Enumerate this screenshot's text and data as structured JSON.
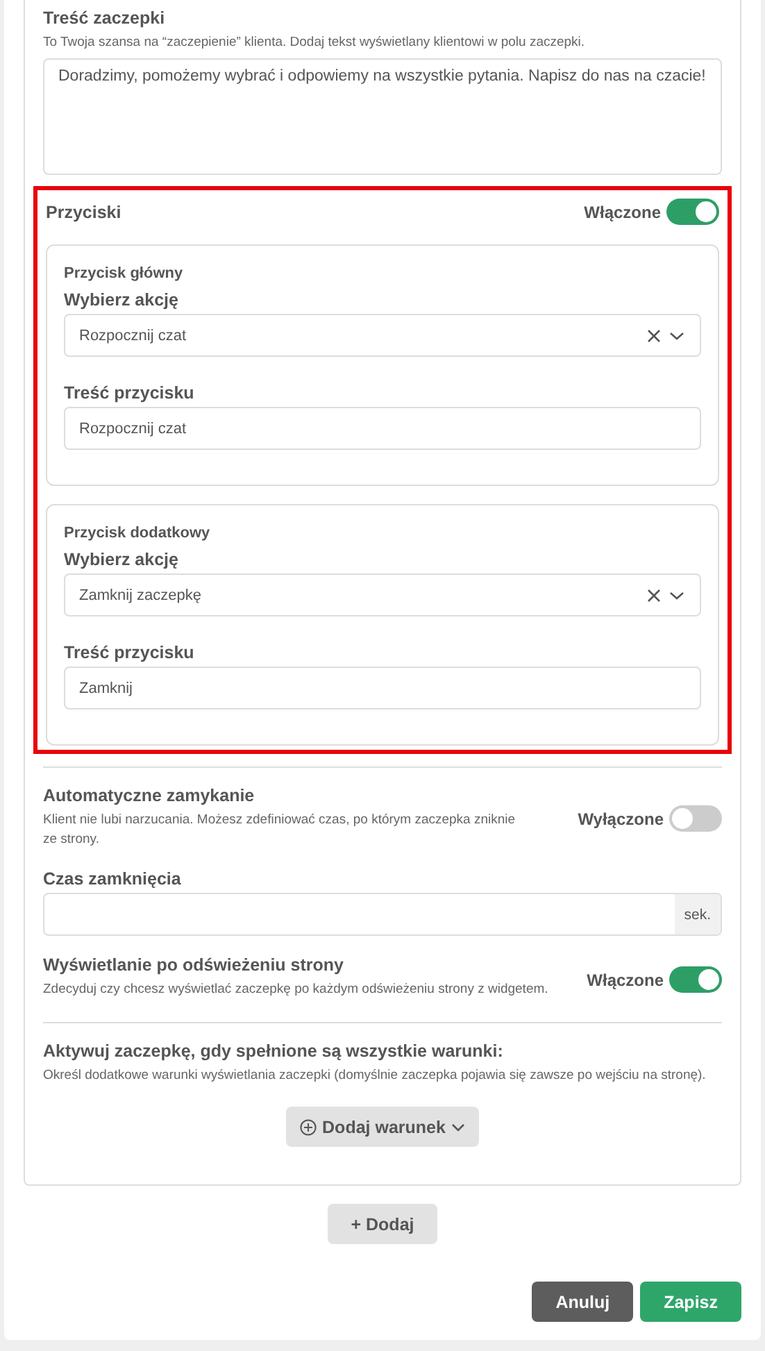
{
  "hook_text": {
    "title": "Treść zaczepki",
    "hint": "To Twoja szansa na “zaczepienie” klienta. Dodaj tekst wyświetlany klientowi w polu zaczepki.",
    "value": "Doradzimy, pomożemy wybrać i odpowiemy na wszystkie pytania. Napisz do nas na czacie!"
  },
  "buttons_section": {
    "title": "Przyciski",
    "toggle_label": "Włączone",
    "on": true,
    "highlighted": true,
    "groups": [
      {
        "title": "Przycisk główny",
        "action_label": "Wybierz akcję",
        "action_value": "Rozpocznij czat",
        "text_label": "Treść przycisku",
        "text_value": "Rozpocznij czat"
      },
      {
        "title": "Przycisk dodatkowy",
        "action_label": "Wybierz akcję",
        "action_value": "Zamknij zaczepkę",
        "text_label": "Treść przycisku",
        "text_value": "Zamknij"
      }
    ]
  },
  "auto_close": {
    "title": "Automatyczne zamykanie",
    "hint": "Klient nie lubi narzucania. Możesz zdefiniować czas, po którym zaczepka zniknie ze strony.",
    "toggle_label": "Wyłączone",
    "on": false
  },
  "close_time": {
    "label": "Czas zamknięcia",
    "unit": "sek."
  },
  "refresh": {
    "title": "Wyświetlanie po odświeżeniu strony",
    "hint": "Zdecyduj czy chcesz wyświetlać zaczepkę po każdym odświeżeniu strony z widgetem.",
    "toggle_label": "Włączone",
    "on": true
  },
  "conditions": {
    "title": "Aktywuj zaczepkę, gdy spełnione są wszystkie warunki:",
    "hint": "Określ dodatkowe warunki wyświetlania zaczepki (domyślnie zaczepka pojawia się zawsze po wejściu na stronę).",
    "add_button": "Dodaj warunek"
  },
  "add_button": "+ Dodaj",
  "footer_buttons": [
    {
      "label": "Anuluj",
      "kind": "cancel"
    },
    {
      "label": "Zapisz",
      "kind": "primary"
    }
  ]
}
